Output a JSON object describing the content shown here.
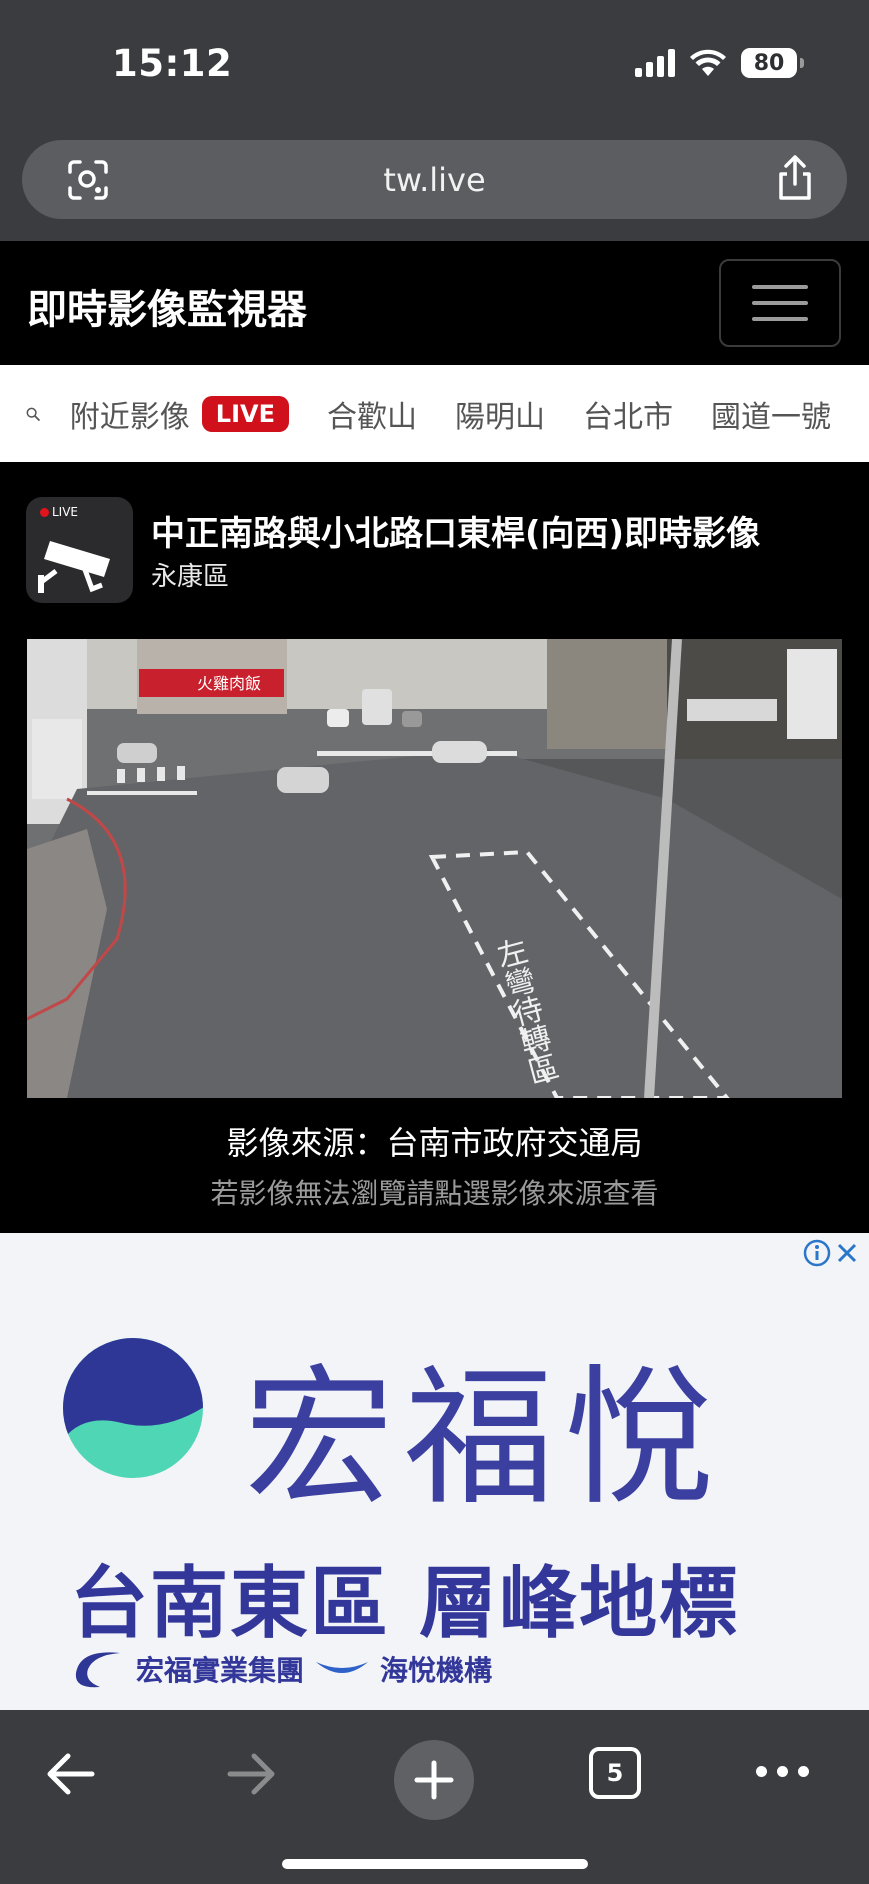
{
  "status_bar": {
    "time": "15:12",
    "battery": "80"
  },
  "browser": {
    "url": "tw.live",
    "tab_count": "5"
  },
  "site": {
    "title": "即時影像監視器"
  },
  "nav": {
    "items": [
      {
        "label": "附近影像",
        "badge": "LIVE"
      },
      {
        "label": "合歡山"
      },
      {
        "label": "陽明山"
      },
      {
        "label": "台北市"
      },
      {
        "label": "國道一號"
      }
    ]
  },
  "camera": {
    "icon_badge": "LIVE",
    "title": "中正南路與小北路口東桿(向西)即時影像",
    "district": "永康區",
    "scene_text": {
      "shop_sign": "火雞肉飯",
      "road_marking": "左彎待轉區"
    }
  },
  "source": {
    "main": "影像來源：台南市政府交通局",
    "sub": "若影像無法瀏覽請點選影像來源查看"
  },
  "ad": {
    "brand": "宏福悅",
    "headline": "台南東區  層峰地標",
    "footer_left": "宏福實業集團",
    "footer_right": "海悅機構",
    "colors": {
      "brand": "#33379a",
      "circle_top": "#2f3796",
      "circle_bottom": "#4fd6b4"
    }
  }
}
